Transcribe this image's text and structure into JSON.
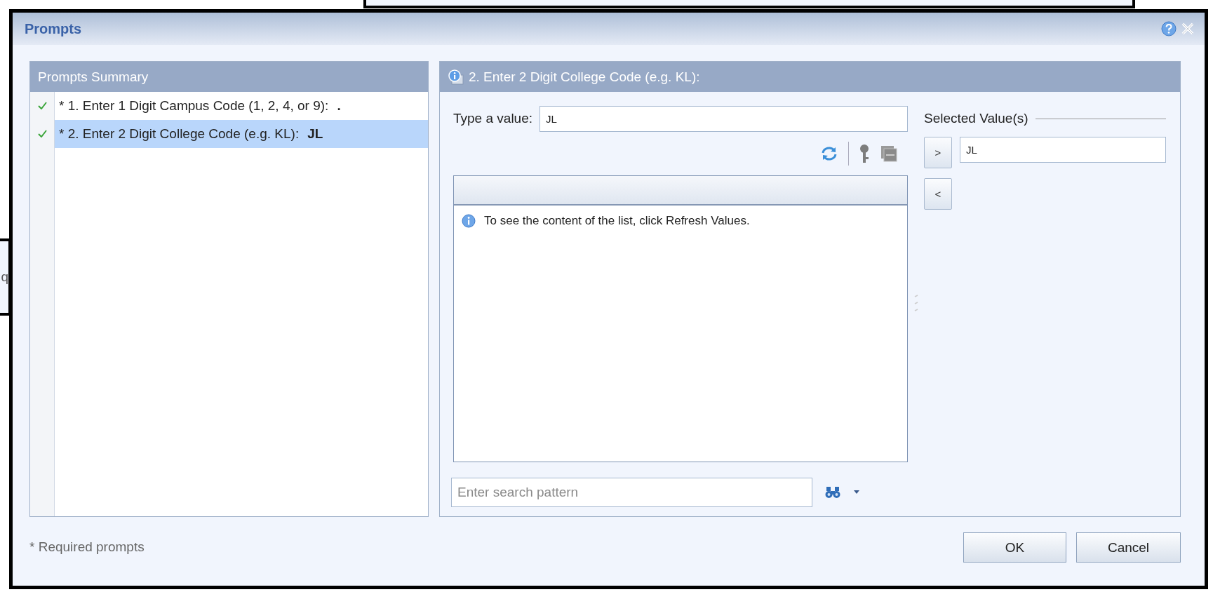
{
  "background": {
    "fragment_text": "q"
  },
  "dialog": {
    "title": "Prompts"
  },
  "summary": {
    "title": "Prompts Summary",
    "items": [
      {
        "text": "* 1. Enter 1 Digit Campus Code (1, 2, 4, or 9):",
        "value": ".",
        "done": true,
        "selected": false
      },
      {
        "text": "* 2. Enter 2 Digit College Code (e.g. KL):",
        "value": "JL",
        "done": true,
        "selected": true
      }
    ]
  },
  "detail": {
    "title": "2. Enter 2 Digit College Code (e.g. KL):",
    "type_label": "Type a value:",
    "type_value": "JL",
    "list_message": "To see the content of the list, click Refresh Values.",
    "search_placeholder": "Enter search pattern",
    "selected_heading": "Selected Value(s)",
    "add_button": ">",
    "remove_button": "<",
    "selected_values": [
      "JL"
    ]
  },
  "footer": {
    "note": "* Required prompts",
    "buttons": [
      "OK",
      "Cancel"
    ]
  }
}
